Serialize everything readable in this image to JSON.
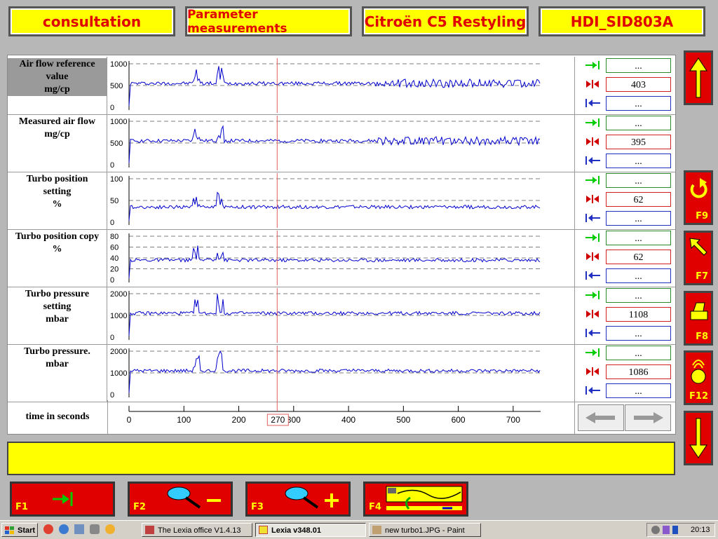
{
  "header": {
    "tab1": "consultation",
    "tab2": "Parameter measurements",
    "tab3": "Citroën C5 Restyling",
    "tab4": "HDI_SID803A"
  },
  "rows": [
    {
      "label": [
        "Air flow reference",
        "value",
        "mg/cp"
      ],
      "y_ticks": [
        "1000",
        "500",
        "0"
      ],
      "top": "...",
      "value": "403",
      "bottom": "..."
    },
    {
      "label": [
        "Measured air flow",
        "mg/cp"
      ],
      "y_ticks": [
        "1000",
        "500",
        "0"
      ],
      "top": "...",
      "value": "395",
      "bottom": "..."
    },
    {
      "label": [
        "Turbo position",
        "setting",
        "%"
      ],
      "y_ticks": [
        "100",
        "50",
        "0"
      ],
      "top": "...",
      "value": "62",
      "bottom": "..."
    },
    {
      "label": [
        "Turbo position copy",
        "%"
      ],
      "y_ticks": [
        "80",
        "60",
        "40",
        "20",
        "0"
      ],
      "top": "...",
      "value": "62",
      "bottom": "..."
    },
    {
      "label": [
        "Turbo pressure",
        "setting",
        "mbar"
      ],
      "y_ticks": [
        "2000",
        "1000",
        "0"
      ],
      "top": "...",
      "value": "1108",
      "bottom": "..."
    },
    {
      "label": [
        "Turbo pressure.",
        "mbar"
      ],
      "y_ticks": [
        "2000",
        "1000",
        "0"
      ],
      "top": "...",
      "value": "1086",
      "bottom": "..."
    }
  ],
  "time_axis": {
    "label": "time in seconds",
    "ticks": [
      "0",
      "100",
      "200",
      "300",
      "400",
      "500",
      "600",
      "700"
    ],
    "cursor": "270"
  },
  "function_keys": {
    "f9": "F9",
    "f7": "F7",
    "f8": "F8",
    "f12": "F12",
    "f1": "F1",
    "f2": "F2",
    "f3": "F3",
    "f4": "F4"
  },
  "taskbar": {
    "start": "Start",
    "task1": "The Lexia office V1.4.13",
    "task2": "Lexia v348.01",
    "task3": "new turbo1.JPG - Paint",
    "clock": "20:13"
  },
  "colors": {
    "accent_yellow": "#ffff00",
    "key_red": "#e00000",
    "trace_blue": "#0000cc",
    "cursor_red": "#e06060"
  }
}
